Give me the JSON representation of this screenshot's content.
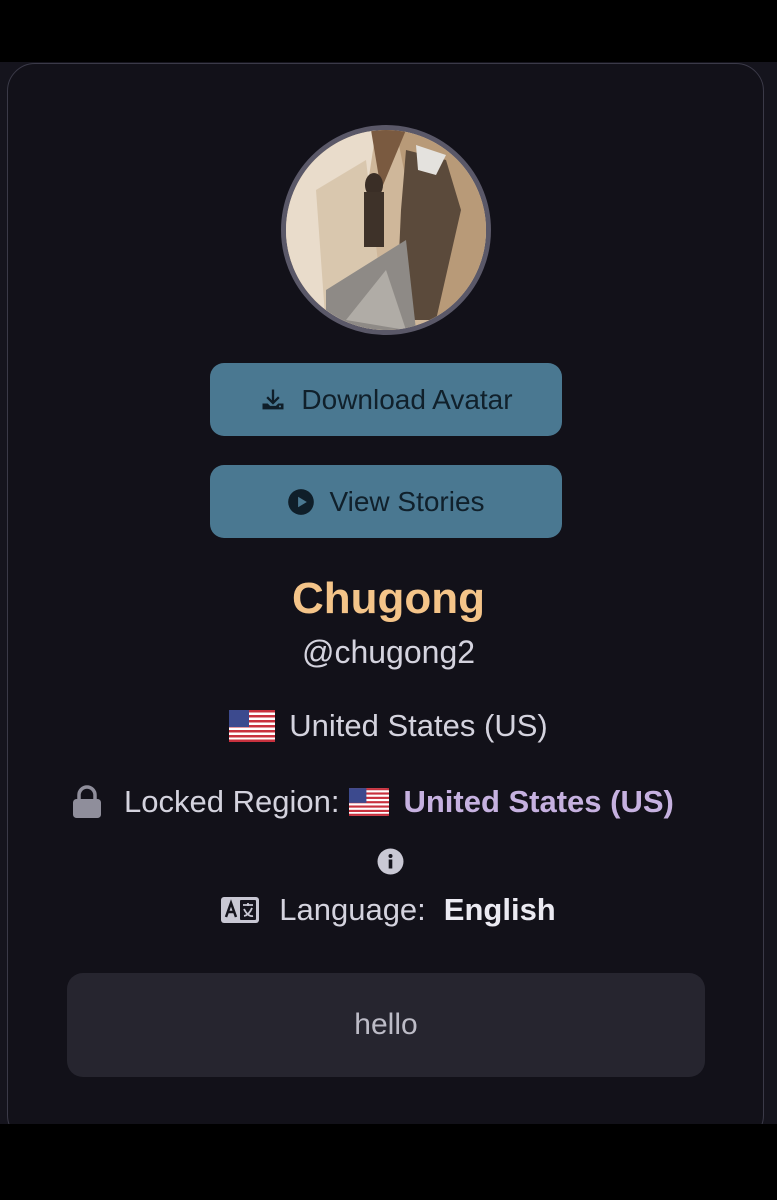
{
  "profile": {
    "display_name": "Chugong",
    "username": "@chugong2",
    "country": "United States (US)",
    "locked_region_label": "Locked Region:",
    "locked_region_value": "United States (US)",
    "language_label": "Language:",
    "language_value": "English",
    "bio": "hello"
  },
  "buttons": {
    "download_avatar": "Download Avatar",
    "view_stories": "View Stories"
  },
  "icons": {
    "download": "download-icon",
    "play": "play-circle-icon",
    "lock": "lock-icon",
    "info": "info-icon",
    "language": "language-translate-icon",
    "flag": "us-flag-icon"
  },
  "colors": {
    "button_bg": "#4a7891",
    "display_name": "#f4c489",
    "locked_region_value": "#c6b1e0",
    "card_bg": "#121119"
  }
}
